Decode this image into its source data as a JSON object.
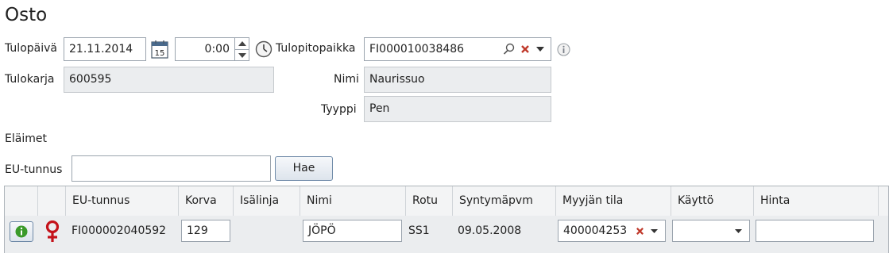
{
  "page": {
    "title": "Osto"
  },
  "arrival": {
    "date_label": "Tulopäivä",
    "date_value": "21.11.2014",
    "calendar_day": "15",
    "time_value": "0:00",
    "origin_label": "Tulopitopaikka",
    "origin_value": "FI000010038486",
    "herd_label": "Tulokarja",
    "herd_value": "600595",
    "name_label": "Nimi",
    "name_value": "Naurissuo",
    "type_label": "Tyyppi",
    "type_value": "Pen"
  },
  "animals": {
    "section_label": "Eläimet",
    "eu_label": "EU-tunnus",
    "eu_value": "",
    "search_button": "Hae"
  },
  "grid": {
    "headers": [
      "EU-tunnus",
      "Korva",
      "Isälinja",
      "Nimi",
      "Rotu",
      "Syntymäpvm",
      "Myyjän tila",
      "Käyttö",
      "Hinta"
    ],
    "rows": [
      {
        "eu_tunnus": "FI000002040592",
        "korva": "129",
        "isalinja": "",
        "nimi": "JÖPÖ",
        "rotu": "SS1",
        "syntymapvm": "09.05.2008",
        "myyjan_tila": "400004253",
        "kaytto": "",
        "hinta": "",
        "sex": "female"
      }
    ]
  },
  "colors": {
    "accent": "#2f6fb3",
    "female_icon": "#c4121a",
    "clear_icon": "#c0392b",
    "info_green": "#3a9a2a"
  }
}
